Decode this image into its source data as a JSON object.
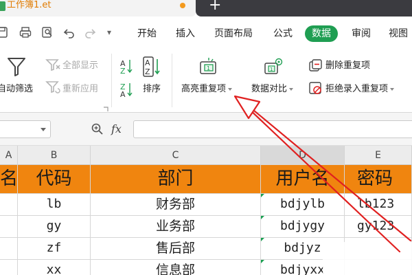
{
  "titlebar": {
    "file_name": "工作簿1.et",
    "new_tab_symbol": "+"
  },
  "quick_access": {
    "icons": [
      "save-icon",
      "print-icon",
      "print-preview-icon",
      "undo-icon",
      "redo-icon",
      "customize-dropdown-icon"
    ],
    "customize_symbol": "▾"
  },
  "menu": {
    "items": [
      "开始",
      "插入",
      "页面布局",
      "公式",
      "数据",
      "审阅",
      "视图"
    ],
    "active": "数据"
  },
  "ribbon": {
    "auto_filter": "自动筛选",
    "show_all": "全部显示",
    "reapply": "重新应用",
    "sort": "排序",
    "highlight_duplicates": "高亮重复项",
    "data_compare": "数据对比",
    "remove_duplicates": "删除重复项",
    "reject_duplicate_entry": "拒绝录入重复项"
  },
  "formula_bar": {
    "fx_label": "fx",
    "formula_value": ""
  },
  "columns": {
    "headers": [
      "A",
      "B",
      "C",
      "D",
      "E"
    ],
    "selected": "D"
  },
  "table": {
    "header": [
      "名",
      "代码",
      "部门",
      "用户名",
      "密码"
    ],
    "rows": [
      [
        "",
        "lb",
        "财务部",
        "bdjylb",
        "lb123"
      ],
      [
        "",
        "gy",
        "业务部",
        "bdjygy",
        "gy123"
      ],
      [
        "",
        "zf",
        "售后部",
        "bdjyz",
        ""
      ],
      [
        "",
        "xx",
        "信息部",
        "bdjyxx",
        ""
      ]
    ]
  },
  "colors": {
    "accent_green": "#1f9e52",
    "header_orange": "#f0850f",
    "arrow_red": "#e02020"
  }
}
